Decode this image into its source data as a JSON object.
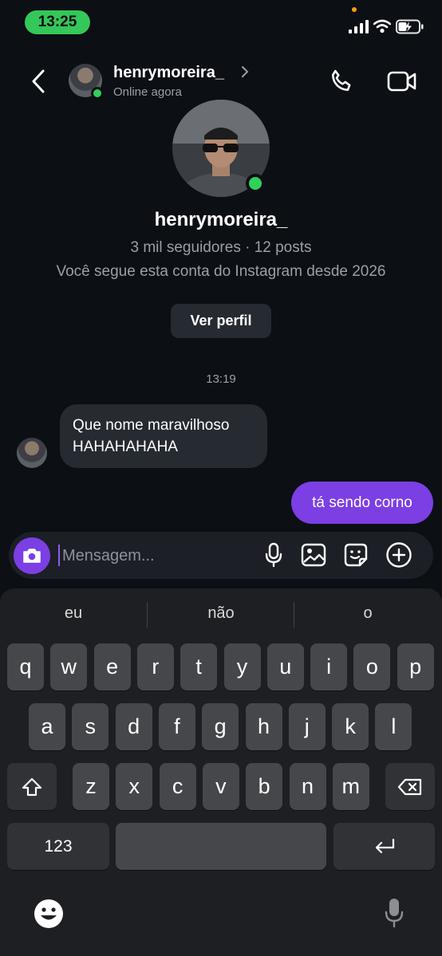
{
  "status_bar": {
    "time": "13:25"
  },
  "header": {
    "username": "henrymoreira_",
    "presence": "Online agora"
  },
  "profile": {
    "name": "henrymoreira_",
    "stats": "3 mil seguidores · 12 posts",
    "follow_info": "Você segue esta conta do Instagram desde 2026",
    "view_profile_label": "Ver perfil"
  },
  "conversation": {
    "timestamp": "13:19",
    "incoming_line1": "Que nome maravilhoso",
    "incoming_line2": "HAHAHAHAHA",
    "outgoing": "tá sendo corno"
  },
  "composer": {
    "placeholder": "Mensagem..."
  },
  "keyboard": {
    "suggestions": [
      "eu",
      "não",
      "o"
    ],
    "row1": [
      "q",
      "w",
      "e",
      "r",
      "t",
      "y",
      "u",
      "i",
      "o",
      "p"
    ],
    "row2": [
      "a",
      "s",
      "d",
      "f",
      "g",
      "h",
      "j",
      "k",
      "l"
    ],
    "row3": [
      "z",
      "x",
      "c",
      "v",
      "b",
      "n",
      "m"
    ],
    "numbers_label": "123"
  },
  "colors": {
    "accent": "#7b3fe4",
    "online": "#30d158",
    "status_pill": "#34c759"
  }
}
